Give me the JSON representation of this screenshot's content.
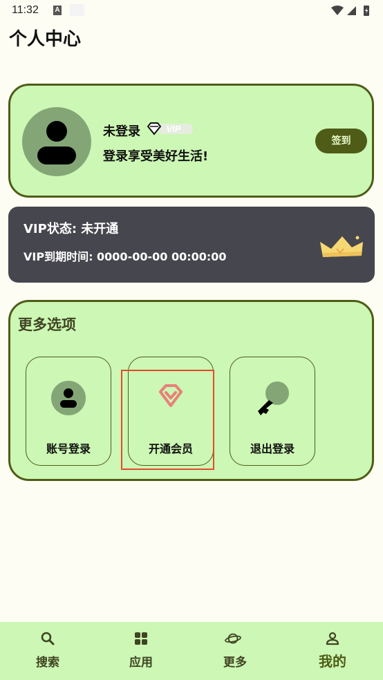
{
  "status_bar": {
    "time": "11:32"
  },
  "page": {
    "title": "个人中心"
  },
  "profile": {
    "username": "未登录",
    "vip_badge": "VIP",
    "tagline": "登录享受美好生活!",
    "signin_label": "签到"
  },
  "vip": {
    "status": "VIP状态: 未开通",
    "expire": "VIP到期时间: 0000-00-00 00:00:00"
  },
  "options": {
    "title": "更多选项",
    "items": [
      {
        "label": "账号登录",
        "icon": "user-icon"
      },
      {
        "label": "开通会员",
        "icon": "diamond-icon"
      },
      {
        "label": "退出登录",
        "icon": "key-icon"
      }
    ]
  },
  "nav": {
    "items": [
      {
        "label": "搜索",
        "icon": "search-icon"
      },
      {
        "label": "应用",
        "icon": "apps-grid-icon"
      },
      {
        "label": "更多",
        "icon": "planet-icon"
      },
      {
        "label": "我的",
        "icon": "person-icon",
        "active": true
      }
    ]
  },
  "colors": {
    "accent": "#4e5c17",
    "card_bg": "#ccf7b4",
    "vip_card_bg": "#46464e",
    "page_bg": "#fdfdf3",
    "highlight": "#e34a2c"
  }
}
